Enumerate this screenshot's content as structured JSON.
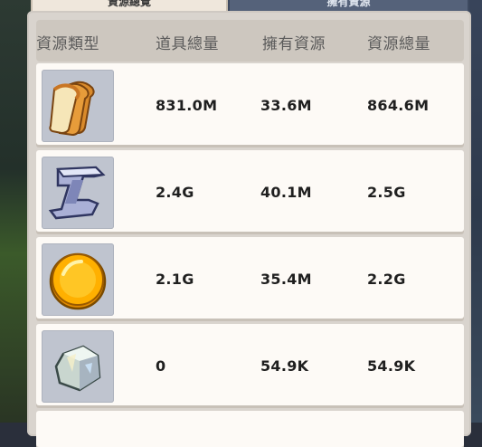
{
  "tabs": [
    {
      "label": "資源總覽"
    },
    {
      "label": "擁有資源"
    }
  ],
  "table": {
    "columns": [
      "資源類型",
      "道具總量",
      "擁有資源",
      "資源總量"
    ],
    "rows": [
      {
        "icon": "bread-icon",
        "item_total": "831.0M",
        "owned": "33.6M",
        "total": "864.6M"
      },
      {
        "icon": "iron-ingot-icon",
        "item_total": "2.4G",
        "owned": "40.1M",
        "total": "2.5G"
      },
      {
        "icon": "gold-coin-icon",
        "item_total": "2.1G",
        "owned": "35.4M",
        "total": "2.2G"
      },
      {
        "icon": "stone-icon",
        "item_total": "0",
        "owned": "54.9K",
        "total": "54.9K"
      }
    ]
  },
  "colors": {
    "panel": "#d9d4ce",
    "row": "#fdfaf6",
    "icon_bg": "#bfc4cf",
    "text": "#1f1f1f"
  }
}
